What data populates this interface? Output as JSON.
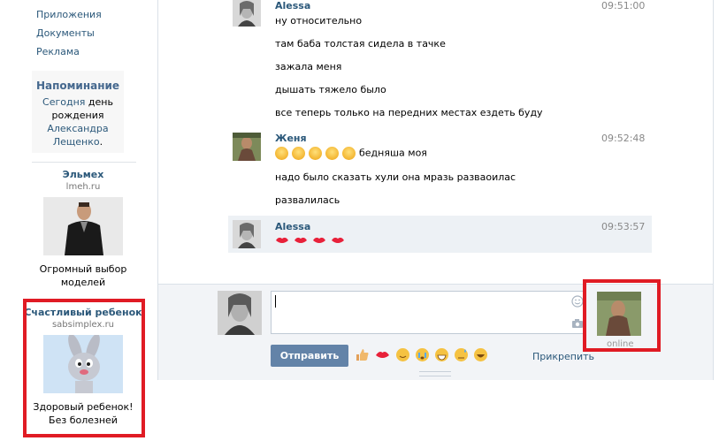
{
  "left_menu": {
    "items": [
      {
        "label": "Приложения"
      },
      {
        "label": "Документы"
      },
      {
        "label": "Реклама"
      }
    ]
  },
  "reminder": {
    "title": "Напоминание",
    "today_link": "Сегодня",
    "text_mid": " день рождения ",
    "person_link": "Александра Лещенко",
    "text_end": "."
  },
  "ads": [
    {
      "title": "Эльмех",
      "domain": "lmeh.ru",
      "image_icon": "man-in-leather-jacket-photo",
      "text": "Огромный выбор моделей"
    },
    {
      "title": "Счастливый ребенок",
      "domain": "sabsimplex.ru",
      "image_icon": "cartoon-rabbit-image",
      "text": "Здоровый ребенок! Без болезней"
    }
  ],
  "messages": [
    {
      "author": "Alessa",
      "time": "09:51:00",
      "lines": [
        "ну относительно",
        "там баба толстая сидела в тачке",
        "зажала меня",
        "дышать тяжело было",
        "все теперь только на передних местах ездеть буду"
      ]
    },
    {
      "author": "Женя",
      "time": "09:52:48",
      "emoji_line_text": "бедняша моя",
      "emoji_count": 5,
      "lines": [
        "надо было сказать хули она мразь развaoилас",
        "развалилась"
      ]
    },
    {
      "author": "Alessa",
      "time": "09:53:57",
      "kiss_count": 4,
      "highlighted": true
    }
  ],
  "composer": {
    "input_value": "",
    "send_label": "Отправить",
    "attach_label": "Прикрепить",
    "quick_emojis": [
      "thumbs-up-icon",
      "kiss-icon",
      "smile-icon",
      "cry-icon",
      "grin-icon",
      "sweat-icon",
      "laugh-icon"
    ]
  },
  "peer": {
    "status": "online"
  },
  "colors": {
    "link": "#2b587a",
    "send_button": "#6383a8",
    "highlight": "#edf1f5",
    "red_annotation": "#e01b24"
  }
}
